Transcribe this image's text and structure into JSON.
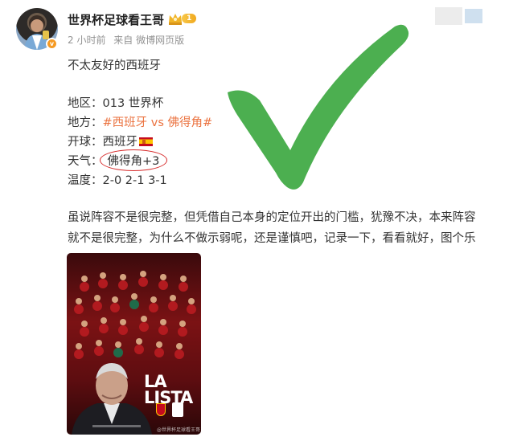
{
  "author": {
    "name": "世界杯足球看王哥",
    "level": "1",
    "meta": {
      "time": "2 小时前",
      "source": "来自 微博网页版"
    }
  },
  "post": {
    "title": "不太友好的西班牙",
    "fields": {
      "region_label": "地区：",
      "region_value": "013  世界杯",
      "teams_label": "地方：",
      "teams_tag": "#西班牙 vs 佛得角#",
      "kickoff_label": "开球：",
      "kickoff_value": "西班牙",
      "weather_label": "天气：",
      "weather_value": "佛得角+3",
      "temp_label": "温度：",
      "temp_value": "2-0  2-1  3-1"
    },
    "body_line1": "虽说阵容不是很完整，但凭借自己本身的定位开出的门槛，犹豫不决，本来阵容",
    "body_line2": "就不是很完整，为什么不做示弱呢，还是谨慎吧，记录一下，看看就好，图个乐"
  },
  "poster": {
    "title": "LA LISTA",
    "watermark": "@世界杯足球看王哥"
  },
  "colors": {
    "accent_orange": "#eb7340",
    "meta_gray": "#939393",
    "check_green": "#4caf50",
    "annotation_red": "#d72b2b"
  },
  "icons": {
    "crown": "crown-icon",
    "verify": "verified-badge-icon",
    "flag": "spain-flag-icon",
    "check": "checkmark-icon"
  }
}
